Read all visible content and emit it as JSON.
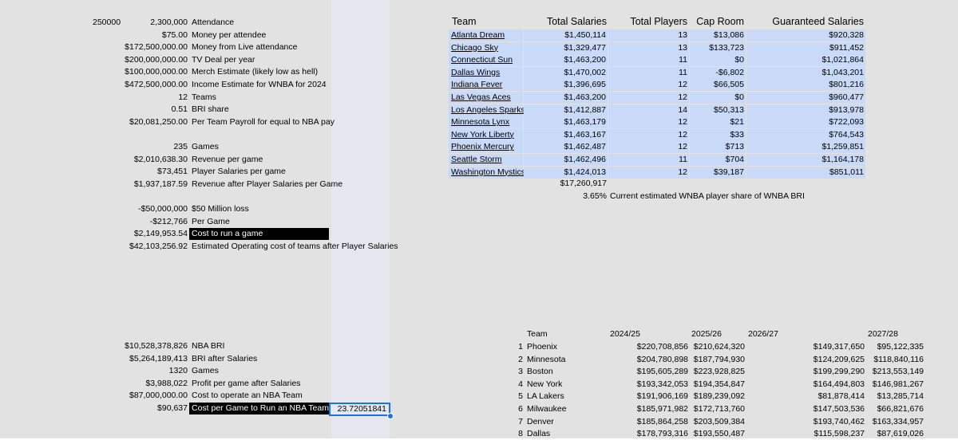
{
  "left_top": {
    "corner": "250000",
    "rows": [
      {
        "value": "2,300,000",
        "label": "Attendance"
      },
      {
        "value": "$75.00",
        "label": "Money per attendee"
      },
      {
        "value": "$172,500,000.00",
        "label": "Money from Live attendance"
      },
      {
        "value": "$200,000,000.00",
        "label": "TV Deal per year"
      },
      {
        "value": "$100,000,000.00",
        "label": "Merch Estimate (likely low as hell)"
      },
      {
        "value": "$472,500,000.00",
        "label": "Income Estimate for WNBA for 2024"
      },
      {
        "value": "12",
        "label": "Teams"
      },
      {
        "value": "0.51",
        "label": "BRI share"
      },
      {
        "value": "$20,081,250.00",
        "label": "Per Team Payroll for equal to NBA pay"
      }
    ],
    "rows2": [
      {
        "value": "235",
        "label": "Games"
      },
      {
        "value": "$2,010,638.30",
        "label": "Revenue per game"
      },
      {
        "value": "$73,451",
        "label": "Player Salaries per game"
      },
      {
        "value": "$1,937,187.59",
        "label": "Revenue after Player Salaries per Game"
      }
    ],
    "rows3": [
      {
        "value": "-$50,000,000",
        "label": "$50 Million loss"
      },
      {
        "value": "-$212,766",
        "label": "Per Game"
      },
      {
        "value": "$2,149,953.54",
        "label": "Cost to run a game"
      },
      {
        "value": "$42,103,256.92",
        "label": "Estimated Operating cost of teams after Player Salaries"
      }
    ]
  },
  "left_bottom": {
    "rows": [
      {
        "value": "$10,528,378,826",
        "label": "NBA BRI"
      },
      {
        "value": "$5,264,189,413",
        "label": "BRI after Salaries"
      },
      {
        "value": "1320",
        "label": "Games"
      },
      {
        "value": "$3,988,022",
        "label": "Profit per game after Salaries"
      },
      {
        "value": "$87,000,000.00",
        "label": "Cost to operate an NBA Team"
      },
      {
        "value": "$90,637",
        "label": "Cost per Game to Run an NBA Team"
      }
    ],
    "selected_value": "23.72051841"
  },
  "wnba": {
    "headers": {
      "team": "Team",
      "salaries": "Total Salaries",
      "players": "Total Players",
      "cap": "Cap Room",
      "guaranteed": "Guaranteed Salaries"
    },
    "rows": [
      {
        "team": "Atlanta Dream",
        "salaries": "$1,450,114",
        "players": "13",
        "cap": "$13,086",
        "guaranteed": "$920,328"
      },
      {
        "team": "Chicago Sky",
        "salaries": "$1,329,477",
        "players": "13",
        "cap": "$133,723",
        "guaranteed": "$911,452"
      },
      {
        "team": "Connecticut Sun",
        "salaries": "$1,463,200",
        "players": "11",
        "cap": "$0",
        "guaranteed": "$1,021,864"
      },
      {
        "team": "Dallas Wings",
        "salaries": "$1,470,002",
        "players": "11",
        "cap": "-$6,802",
        "guaranteed": "$1,043,201"
      },
      {
        "team": "Indiana Fever",
        "salaries": "$1,396,695",
        "players": "12",
        "cap": "$66,505",
        "guaranteed": "$801,216"
      },
      {
        "team": "Las Vegas Aces",
        "salaries": "$1,463,200",
        "players": "12",
        "cap": "$0",
        "guaranteed": "$960,477"
      },
      {
        "team": "Los Angeles Sparks",
        "salaries": "$1,412,887",
        "players": "14",
        "cap": "$50,313",
        "guaranteed": "$913,978"
      },
      {
        "team": "Minnesota Lynx",
        "salaries": "$1,463,179",
        "players": "12",
        "cap": "$21",
        "guaranteed": "$722,093"
      },
      {
        "team": "New York Liberty",
        "salaries": "$1,463,167",
        "players": "12",
        "cap": "$33",
        "guaranteed": "$764,543"
      },
      {
        "team": "Phoenix Mercury",
        "salaries": "$1,462,487",
        "players": "12",
        "cap": "$713",
        "guaranteed": "$1,259,851"
      },
      {
        "team": "Seattle Storm",
        "salaries": "$1,462,496",
        "players": "11",
        "cap": "$704",
        "guaranteed": "$1,164,178"
      },
      {
        "team": "Washington Mystics",
        "salaries": "$1,424,013",
        "players": "12",
        "cap": "$39,187",
        "guaranteed": "$851,011"
      }
    ],
    "total": "$17,260,917",
    "share_pct": "3.65%",
    "share_label": "Current estimated WNBA player share of WNBA BRI"
  },
  "nba": {
    "headers": {
      "team": "Team",
      "y1": "2024/25",
      "y2": "2025/26",
      "y3": "2026/27",
      "y4": "2027/28"
    },
    "rows": [
      {
        "rank": "1",
        "team": "Phoenix",
        "y1": "$220,708,856",
        "y2": "$210,624,320",
        "y3": "$149,317,650",
        "y4": "$95,122,335"
      },
      {
        "rank": "2",
        "team": "Minnesota",
        "y1": "$204,780,898",
        "y2": "$187,794,930",
        "y3": "$124,209,625",
        "y4": "$118,840,116"
      },
      {
        "rank": "3",
        "team": "Boston",
        "y1": "$195,605,289",
        "y2": "$223,928,825",
        "y3": "$199,299,290",
        "y4": "$213,553,149"
      },
      {
        "rank": "4",
        "team": "New York",
        "y1": "$193,342,053",
        "y2": "$194,354,847",
        "y3": "$164,494,803",
        "y4": "$146,981,267"
      },
      {
        "rank": "5",
        "team": "LA Lakers",
        "y1": "$191,906,169",
        "y2": "$189,239,092",
        "y3": "$81,878,414",
        "y4": "$13,285,714"
      },
      {
        "rank": "6",
        "team": "Milwaukee",
        "y1": "$185,971,982",
        "y2": "$172,713,760",
        "y3": "$147,503,536",
        "y4": "$66,821,676"
      },
      {
        "rank": "7",
        "team": "Denver",
        "y1": "$185,864,258",
        "y2": "$203,509,384",
        "y3": "$193,740,462",
        "y4": "$163,334,957"
      },
      {
        "rank": "8",
        "team": "Dallas",
        "y1": "$178,793,316",
        "y2": "$193,550,487",
        "y3": "$115,598,237",
        "y4": "$87,619,026"
      }
    ]
  }
}
